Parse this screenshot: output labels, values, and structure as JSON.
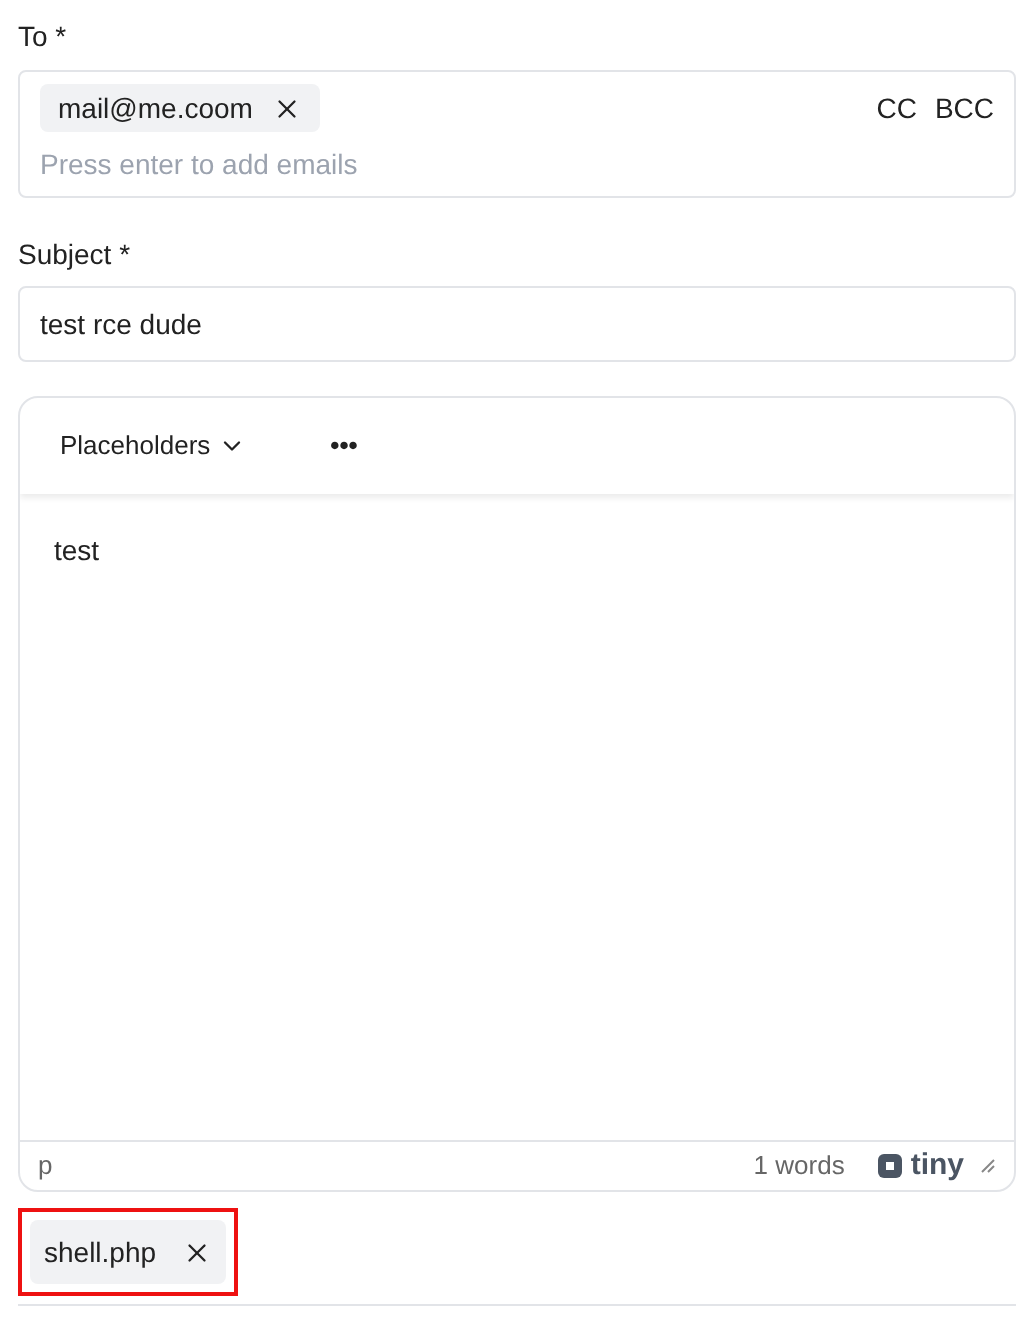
{
  "to": {
    "label": "To *",
    "chips": [
      "mail@me.coom"
    ],
    "cc": "CC",
    "bcc": "BCC",
    "placeholder": "Press enter to add emails"
  },
  "subject": {
    "label": "Subject *",
    "value": "test rce dude"
  },
  "editor": {
    "toolbar": {
      "placeholders": "Placeholders",
      "more": "•••"
    },
    "body": "test",
    "status": {
      "element": "p",
      "word_count": "1 words",
      "brand": "tiny"
    }
  },
  "attachments": [
    {
      "name": "shell.php",
      "highlighted": true
    }
  ]
}
